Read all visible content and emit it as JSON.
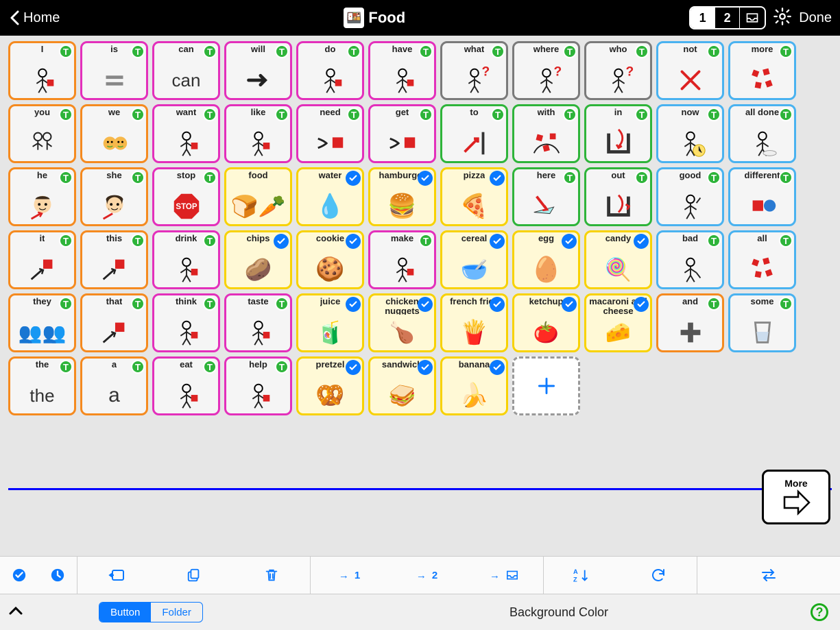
{
  "header": {
    "home_label": "Home",
    "title": "Food",
    "page1": "1",
    "page2": "2",
    "storage_icon": "storage",
    "done_label": "Done"
  },
  "rows": [
    [
      {
        "label": "I",
        "color": "orange",
        "badge": "T",
        "icon": "person-point-self"
      },
      {
        "label": "is",
        "color": "magenta",
        "badge": "T",
        "icon": "equals"
      },
      {
        "label": "can",
        "color": "magenta",
        "badge": "T",
        "icon": "text-can"
      },
      {
        "label": "will",
        "color": "magenta",
        "badge": "T",
        "icon": "arrow-right"
      },
      {
        "label": "do",
        "color": "magenta",
        "badge": "T",
        "icon": "person-reach"
      },
      {
        "label": "have",
        "color": "magenta",
        "badge": "T",
        "icon": "person-hold"
      },
      {
        "label": "what",
        "color": "gray",
        "badge": "T",
        "icon": "question"
      },
      {
        "label": "where",
        "color": "gray",
        "badge": "T",
        "icon": "question"
      },
      {
        "label": "who",
        "color": "gray",
        "badge": "T",
        "icon": "question"
      },
      {
        "label": "not",
        "color": "lblue",
        "badge": "T",
        "icon": "x-red"
      },
      {
        "label": "more",
        "color": "lblue",
        "badge": "T",
        "icon": "squares"
      }
    ],
    [
      {
        "label": "you",
        "color": "orange",
        "badge": "T",
        "icon": "two-people"
      },
      {
        "label": "we",
        "color": "orange",
        "badge": "T",
        "icon": "two-faces"
      },
      {
        "label": "want",
        "color": "magenta",
        "badge": "T",
        "icon": "person-want"
      },
      {
        "label": "like",
        "color": "magenta",
        "badge": "T",
        "icon": "person-like"
      },
      {
        "label": "need",
        "color": "magenta",
        "badge": "T",
        "icon": "hands-reach"
      },
      {
        "label": "get",
        "color": "magenta",
        "badge": "T",
        "icon": "hands-take"
      },
      {
        "label": "to",
        "color": "green",
        "badge": "T",
        "icon": "arrow-to"
      },
      {
        "label": "with",
        "color": "green",
        "badge": "T",
        "icon": "squares-circle"
      },
      {
        "label": "in",
        "color": "green",
        "badge": "T",
        "icon": "arrow-in"
      },
      {
        "label": "now",
        "color": "lblue",
        "badge": "T",
        "icon": "clock"
      },
      {
        "label": "all done",
        "color": "lblue",
        "badge": "T",
        "icon": "plate"
      }
    ],
    [
      {
        "label": "he",
        "color": "orange",
        "badge": "T",
        "icon": "boy-face"
      },
      {
        "label": "she",
        "color": "orange",
        "badge": "T",
        "icon": "girl-face"
      },
      {
        "label": "stop",
        "color": "magenta",
        "badge": "T",
        "icon": "stop-sign"
      },
      {
        "label": "food",
        "color": "yellow",
        "badge": null,
        "icon": "food"
      },
      {
        "label": "water",
        "color": "yellow",
        "badge": "check",
        "icon": "water"
      },
      {
        "label": "hamburger",
        "color": "yellow",
        "badge": "check",
        "icon": "burger"
      },
      {
        "label": "pizza",
        "color": "yellow",
        "badge": "check",
        "icon": "pizza"
      },
      {
        "label": "here",
        "color": "green",
        "badge": "T",
        "icon": "arrow-here"
      },
      {
        "label": "out",
        "color": "green",
        "badge": "T",
        "icon": "arrow-out"
      },
      {
        "label": "good",
        "color": "lblue",
        "badge": "T",
        "icon": "thumbs-up"
      },
      {
        "label": "different",
        "color": "lblue",
        "badge": "T",
        "icon": "shapes"
      }
    ],
    [
      {
        "label": "it",
        "color": "orange",
        "badge": "T",
        "icon": "point-square"
      },
      {
        "label": "this",
        "color": "orange",
        "badge": "T",
        "icon": "point-square"
      },
      {
        "label": "drink",
        "color": "magenta",
        "badge": "T",
        "icon": "person-drink"
      },
      {
        "label": "chips",
        "color": "yellow",
        "badge": "check",
        "icon": "chips"
      },
      {
        "label": "cookie",
        "color": "yellow",
        "badge": "check",
        "icon": "cookie"
      },
      {
        "label": "make",
        "color": "magenta",
        "badge": "T",
        "icon": "person-make"
      },
      {
        "label": "cereal",
        "color": "yellow",
        "badge": "check",
        "icon": "cereal"
      },
      {
        "label": "egg",
        "color": "yellow",
        "badge": "check",
        "icon": "egg"
      },
      {
        "label": "candy",
        "color": "yellow",
        "badge": "check",
        "icon": "candy"
      },
      {
        "label": "bad",
        "color": "lblue",
        "badge": "T",
        "icon": "thumbs-down"
      },
      {
        "label": "all",
        "color": "lblue",
        "badge": "T",
        "icon": "squares"
      }
    ],
    [
      {
        "label": "they",
        "color": "orange",
        "badge": "T",
        "icon": "group"
      },
      {
        "label": "that",
        "color": "orange",
        "badge": "T",
        "icon": "point-square"
      },
      {
        "label": "think",
        "color": "magenta",
        "badge": "T",
        "icon": "person-think"
      },
      {
        "label": "taste",
        "color": "magenta",
        "badge": "T",
        "icon": "person-eat"
      },
      {
        "label": "juice",
        "color": "yellow",
        "badge": "check",
        "icon": "juice"
      },
      {
        "label": "chicken nuggets",
        "color": "yellow",
        "badge": "check",
        "icon": "nuggets"
      },
      {
        "label": "french fries",
        "color": "yellow",
        "badge": "check",
        "icon": "fries"
      },
      {
        "label": "ketchup",
        "color": "yellow",
        "badge": "check",
        "icon": "ketchup"
      },
      {
        "label": "macaroni and cheese",
        "color": "yellow",
        "badge": "check",
        "icon": "mac"
      },
      {
        "label": "and",
        "color": "orange",
        "badge": "T",
        "icon": "plus"
      },
      {
        "label": "some",
        "color": "lblue",
        "badge": "T",
        "icon": "glass"
      }
    ],
    [
      {
        "label": "the",
        "color": "orange",
        "badge": "T",
        "icon": "text-the"
      },
      {
        "label": "a",
        "color": "orange",
        "badge": "T",
        "icon": "text-a"
      },
      {
        "label": "eat",
        "color": "magenta",
        "badge": "T",
        "icon": "person-eat"
      },
      {
        "label": "help",
        "color": "magenta",
        "badge": "T",
        "icon": "person-help"
      },
      {
        "label": "pretzel",
        "color": "yellow",
        "badge": "check",
        "icon": "pretzel"
      },
      {
        "label": "sandwich",
        "color": "yellow",
        "badge": "check",
        "icon": "sandwich"
      },
      {
        "label": "banana",
        "color": "yellow",
        "badge": "check",
        "icon": "banana"
      },
      {
        "label": "+",
        "color": "dashed",
        "badge": null,
        "icon": "add"
      }
    ]
  ],
  "more_button": {
    "label": "More",
    "page": "2"
  },
  "toolbar": {
    "select_all": "select-all",
    "deselect_all": "deselect-all",
    "move": "move",
    "copy": "copy",
    "delete": "delete",
    "to1": "→1",
    "to2": "→2",
    "to_storage": "→▢",
    "sort": "A↕Z",
    "refresh": "refresh",
    "swap": "swap"
  },
  "footer": {
    "button_tab": "Button",
    "folder_tab": "Folder",
    "bg_label": "Background Color"
  }
}
